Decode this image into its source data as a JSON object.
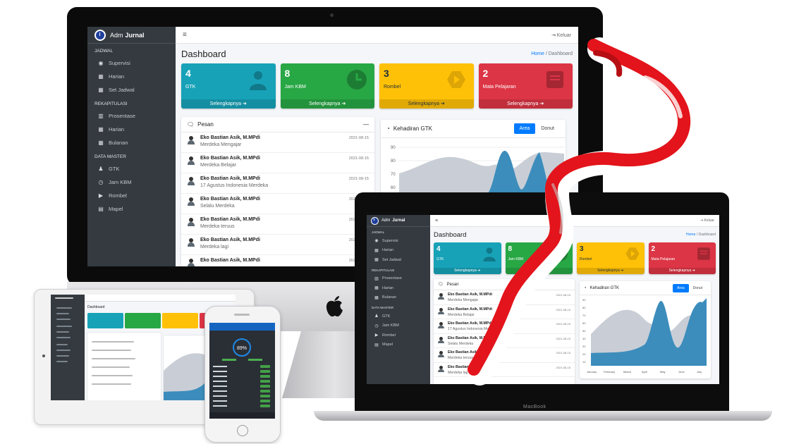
{
  "app": {
    "brand_prefix": "Adm",
    "brand_strong": "Jurnal",
    "logout_label": "Keluar",
    "page_title": "Dashboard",
    "breadcrumb_home": "Home",
    "breadcrumb_sep": "/",
    "breadcrumb_current": "Dashboard"
  },
  "sidebar": {
    "sections": [
      {
        "header": "JADWAL",
        "items": [
          {
            "label": "Supervisi",
            "icon": "eye-icon"
          },
          {
            "label": "Harian",
            "icon": "calendar-icon"
          },
          {
            "label": "Set Jadwal",
            "icon": "calendar-icon"
          }
        ]
      },
      {
        "header": "REKAPITULASI",
        "items": [
          {
            "label": "Prosentase",
            "icon": "chart-icon"
          },
          {
            "label": "Harian",
            "icon": "calendar-icon"
          },
          {
            "label": "Bulanan",
            "icon": "calendar-icon"
          }
        ]
      },
      {
        "header": "DATA MASTER",
        "items": [
          {
            "label": "GTK",
            "icon": "users-icon"
          },
          {
            "label": "Jam KBM",
            "icon": "clock-icon"
          },
          {
            "label": "Rombel",
            "icon": "play-circle-icon"
          },
          {
            "label": "Mapel",
            "icon": "book-icon"
          }
        ]
      }
    ]
  },
  "stats": [
    {
      "value": "4",
      "label": "GTK",
      "more": "Selengkapnya",
      "color": "#17a2b8",
      "icon": "users-icon"
    },
    {
      "value": "8",
      "label": "Jam KBM",
      "more": "Selengkapnya",
      "color": "#28a745",
      "icon": "clock-icon"
    },
    {
      "value": "3",
      "label": "Rombel",
      "more": "Selengkapnya",
      "color": "#ffc107",
      "icon": "play-circle-icon"
    },
    {
      "value": "2",
      "label": "Mata Pelajaran",
      "more": "Selengkapnya",
      "color": "#dc3545",
      "icon": "book-icon"
    }
  ],
  "messages": {
    "title": "Pesan",
    "collapse": "—",
    "items": [
      {
        "name": "Eko Bastian Asik, M.MPdi",
        "text": "Merdeka Mengajar",
        "date": "2021-08-15"
      },
      {
        "name": "Eko Bastian Asik, M.MPdi",
        "text": "Merdeka Belajar",
        "date": "2021-08-15"
      },
      {
        "name": "Eko Bastian Asik, M.MPdi",
        "text": "17 Agustus Indonesia Merdeka",
        "date": "2021-08-15"
      },
      {
        "name": "Eko Bastian Asik, M.MPdi",
        "text": "Selalu Merdeka",
        "date": "2021-08-15"
      },
      {
        "name": "Eko Bastian Asik, M.MPdi",
        "text": "Merdeka teruus",
        "date": "2021-08-15"
      },
      {
        "name": "Eko Bastian Asik, M.MPdi",
        "text": "Merdeka lagi",
        "date": "2021-08-15"
      },
      {
        "name": "Eko Bastian Asik, M.MPdi",
        "text": "",
        "date": "2021-08-15"
      }
    ]
  },
  "attendance": {
    "title": "Kehadiran GTK",
    "toggle_active": "Area",
    "toggle_inactive": "Donut",
    "y_ticks": [
      "90",
      "80",
      "70",
      "60",
      "50",
      "40",
      "30",
      "20",
      "10"
    ],
    "x_labels": [
      "January",
      "February",
      "March",
      "April",
      "May",
      "June",
      "July"
    ]
  },
  "laptop_label": "MacBook",
  "phone": {
    "gauge_value": "89%"
  },
  "colors": {
    "sidebar": "#343a40",
    "primary": "#007bff",
    "area_grey": "#c9ced6",
    "area_blue": "#3c8dbc",
    "flag_red": "#e3141b"
  }
}
